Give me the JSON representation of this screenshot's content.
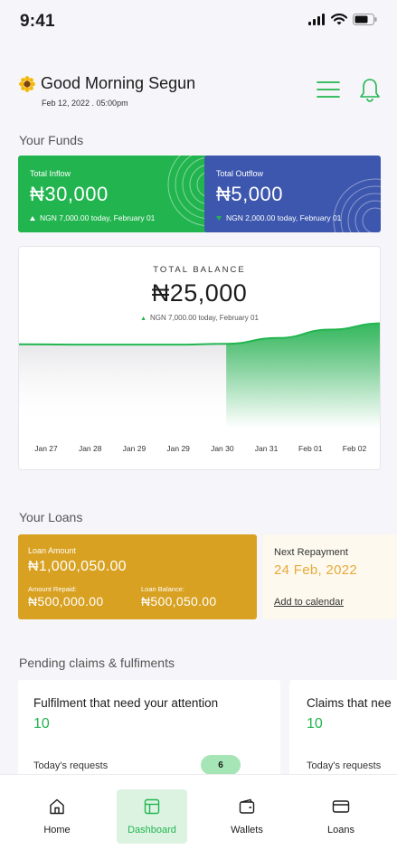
{
  "status_bar": {
    "time": "9:41"
  },
  "header": {
    "greeting": "Good Morning Segun",
    "date": "Feb 12, 2022 . 05:00pm",
    "icons": {
      "menu": "hamburger-menu-icon",
      "notifications": "bell-icon",
      "greeting": "sunflower-icon"
    }
  },
  "funds": {
    "title": "Your Funds",
    "inflow": {
      "label": "Total Inflow",
      "amount": "₦30,000",
      "note": "NGN 7,000.00 today, February 01",
      "trend": "up",
      "color": "#22b54f"
    },
    "outflow": {
      "label": "Total Outflow",
      "amount": "₦5,000",
      "note": "NGN 2,000.00 today, February 01",
      "trend": "down",
      "color": "#3d57ae"
    }
  },
  "balance": {
    "label": "TOTAL BALANCE",
    "amount": "₦25,000",
    "note": "NGN 7,000.00 today, February 01"
  },
  "chart_data": {
    "type": "area",
    "x": [
      "Jan 27",
      "Jan 28",
      "Jan 29",
      "Jan 29",
      "Jan 30",
      "Jan 31",
      "Feb 01",
      "Feb 02"
    ],
    "series": [
      {
        "values": [
          20000,
          19900,
          19900,
          19900,
          20100,
          21500,
          23500,
          25000
        ]
      }
    ],
    "ylim": [
      0,
      26000
    ],
    "grid": false,
    "color": "#22b54f"
  },
  "loans": {
    "title": "Your Loans",
    "loan_amount_label": "Loan Amount",
    "loan_amount": "₦1,000,050.00",
    "repaid_label": "Amount Repaid:",
    "repaid": "₦500,000.00",
    "balance_label": "Loan Balance:",
    "balance": "₦500,050.00",
    "color": "#d8a121",
    "next_repayment": {
      "label": "Next Repayment",
      "date": "24 Feb, 2022",
      "link": "Add to calendar"
    }
  },
  "pending": {
    "title": "Pending claims & fulfiments",
    "cards": [
      {
        "title": "Fulfilment that need your attention",
        "count": "10",
        "requests_label": "Today's requests",
        "badge": "6"
      },
      {
        "title": "Claims that nee",
        "count": "10",
        "requests_label": "Today's requests"
      }
    ]
  },
  "nav": {
    "items": [
      {
        "label": "Home",
        "icon": "home-icon"
      },
      {
        "label": "Dashboard",
        "icon": "dashboard-icon",
        "active": true
      },
      {
        "label": "Wallets",
        "icon": "wallet-icon"
      },
      {
        "label": "Loans",
        "icon": "card-icon"
      }
    ]
  }
}
